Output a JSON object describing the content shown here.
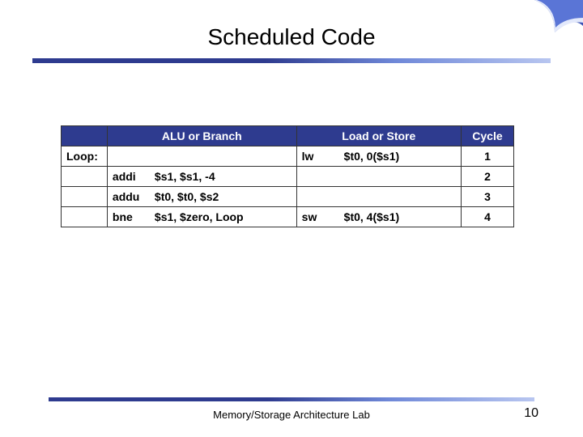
{
  "title": "Scheduled Code",
  "footer": {
    "lab": "Memory/Storage Architecture Lab",
    "page": "10"
  },
  "table": {
    "headers": {
      "label": "",
      "alu": "ALU or Branch",
      "ls": "Load or Store",
      "cycle": "Cycle"
    },
    "rows": [
      {
        "label": "Loop:",
        "alu_op": "",
        "alu_args": "",
        "ls_op": "lw",
        "ls_args": "$t0, 0($s1)",
        "cycle": "1"
      },
      {
        "label": "",
        "alu_op": "addi",
        "alu_args": "$s1, $s1, -4",
        "ls_op": "",
        "ls_args": "",
        "cycle": "2"
      },
      {
        "label": "",
        "alu_op": "addu",
        "alu_args": "$t0, $t0, $s2",
        "ls_op": "",
        "ls_args": "",
        "cycle": "3"
      },
      {
        "label": "",
        "alu_op": "bne",
        "alu_args": "$s1, $zero, Loop",
        "ls_op": "sw",
        "ls_args": "$t0, 4($s1)",
        "cycle": "4"
      }
    ]
  }
}
